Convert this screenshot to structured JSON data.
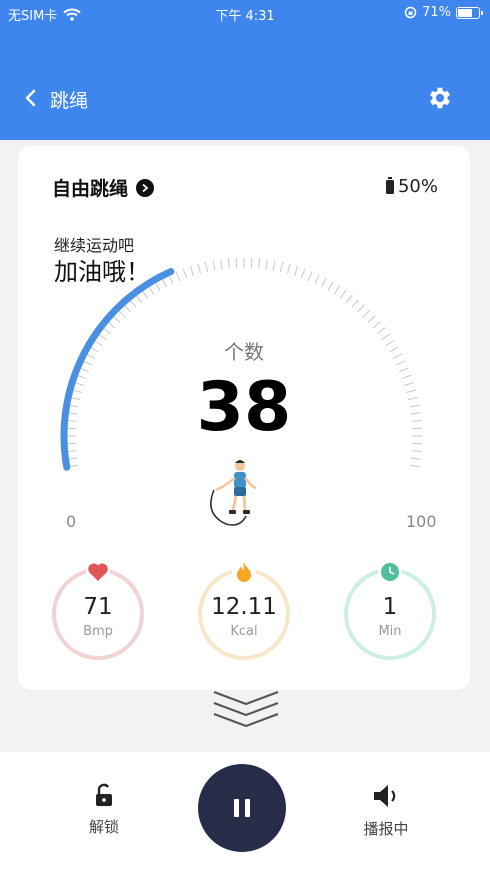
{
  "status_bar": {
    "carrier": "无SIM卡",
    "time": "下午 4:31",
    "battery_percent": "71%",
    "battery_level": 0.71
  },
  "navbar": {
    "title": "跳绳",
    "back_icon": "chevron-left-icon",
    "settings_icon": "gear-icon"
  },
  "card": {
    "mode": "自由跳绳",
    "device_battery": "50%",
    "encourage_line1": "继续运动吧",
    "encourage_line2": "加油哦！",
    "count_label": "个数",
    "count": "38",
    "gauge": {
      "min": "0",
      "max": "100",
      "min_value": 0,
      "max_value": 100,
      "value": 38,
      "progress_color": "#4a90e2"
    },
    "metrics": [
      {
        "value": "71",
        "unit": "Bmp",
        "icon": "heart-icon",
        "color": "#e05555",
        "ring": "#f2d3d3"
      },
      {
        "value": "12.11",
        "unit": "Kcal",
        "icon": "flame-icon",
        "color": "#f5a623",
        "ring": "#f7e7c9"
      },
      {
        "value": "1",
        "unit": "Min",
        "icon": "clock-icon",
        "color": "#4fbf9f",
        "ring": "#cdeee4"
      }
    ]
  },
  "bottom_bar": {
    "unlock_label": "解锁",
    "broadcast_label": "播报中",
    "pause_icon": "pause-icon"
  },
  "colors": {
    "header": "#3e86ee",
    "pause_button": "#272d48"
  }
}
